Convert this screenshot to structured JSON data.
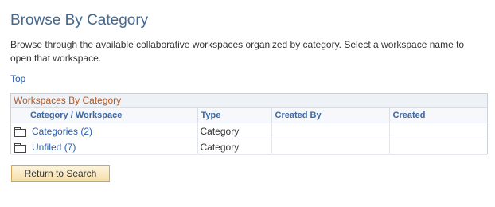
{
  "header": {
    "title": "Browse By Category"
  },
  "description": "Browse through the available collaborative workspaces organized by category. Select a workspace name to open that workspace.",
  "top_link": "Top",
  "grid": {
    "title": "Workspaces By Category",
    "columns": [
      "Category / Workspace",
      "Type",
      "Created By",
      "Created"
    ],
    "rows": [
      {
        "name": "Categories (2)",
        "icon": "folder-icon",
        "type": "Category",
        "created_by": "",
        "created": ""
      },
      {
        "name": "Unfiled (7)",
        "icon": "folder-icon",
        "type": "Category",
        "created_by": "",
        "created": ""
      }
    ]
  },
  "buttons": {
    "return_to_search": "Return to Search"
  },
  "colors": {
    "title": "#46698f",
    "link": "#2a5db0",
    "grid_title": "#b15a2b",
    "button_fill": "#f5dfaa",
    "button_border": "#d4a55a"
  }
}
